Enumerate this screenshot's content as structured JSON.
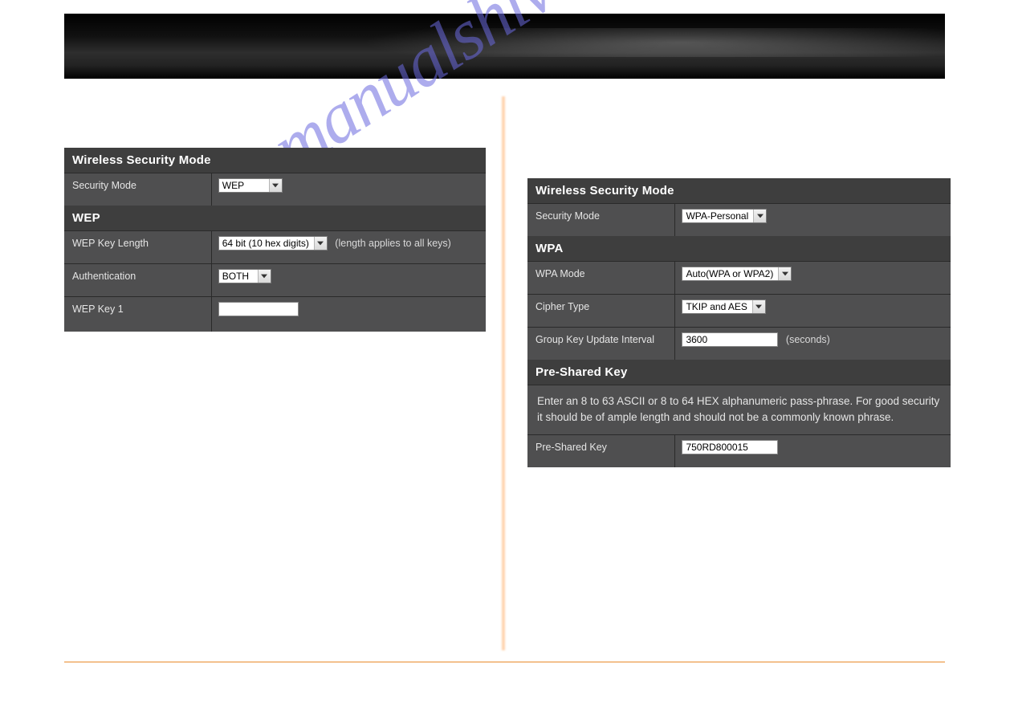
{
  "watermark": "manualshive.com",
  "left": {
    "mode_header": "Wireless Security Mode",
    "security_mode_label": "Security Mode",
    "security_mode_value": "WEP",
    "wep_header": "WEP",
    "wep_key_length_label": "WEP Key Length",
    "wep_key_length_value": "64 bit (10 hex digits)",
    "wep_key_length_hint": "(length applies to all keys)",
    "authentication_label": "Authentication",
    "authentication_value": "BOTH",
    "wep_key1_label": "WEP Key 1",
    "wep_key1_value": ""
  },
  "right": {
    "mode_header": "Wireless Security Mode",
    "security_mode_label": "Security Mode",
    "security_mode_value": "WPA-Personal",
    "wpa_header": "WPA",
    "wpa_mode_label": "WPA Mode",
    "wpa_mode_value": "Auto(WPA or WPA2)",
    "cipher_label": "Cipher Type",
    "cipher_value": "TKIP and AES",
    "gku_label": "Group Key Update Interval",
    "gku_value": "3600",
    "gku_unit": "(seconds)",
    "psk_header": "Pre-Shared Key",
    "psk_desc": "Enter an 8 to 63 ASCII or 8 to 64 HEX alphanumeric pass-phrase. For good security it should be of ample length and should not be a commonly known phrase.",
    "psk_label": "Pre-Shared Key",
    "psk_value": "750RD800015"
  }
}
